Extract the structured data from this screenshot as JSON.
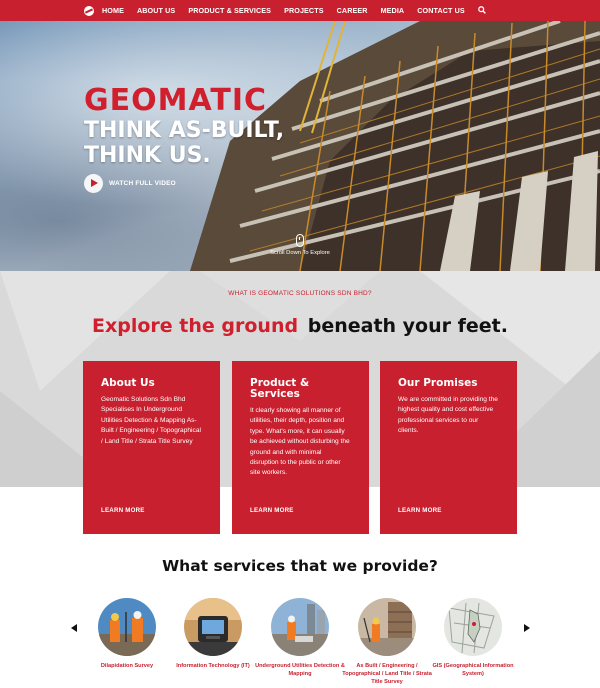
{
  "nav": {
    "items": [
      "HOME",
      "ABOUT US",
      "PRODUCT & SERVICES",
      "PROJECTS",
      "CAREER",
      "MEDIA",
      "CONTACT US"
    ],
    "search_icon": "search-icon",
    "accent": "#c8202e"
  },
  "hero": {
    "brand": "GEOMATIC",
    "headline_line1": "THINK AS-BUILT,",
    "headline_line2": "THINK US.",
    "watch_label": "WATCH FULL VIDEO",
    "scroll_label": "Scroll Down To Explore"
  },
  "intro": {
    "eyebrow": "WHAT IS GEOMATIC SOLUTIONS SDN BHD?",
    "title_red": "Explore the ground",
    "title_dark": "beneath your feet."
  },
  "cards": [
    {
      "title": "About Us",
      "body": "Geomatic Solutions Sdn Bhd Specialises In Underground Utilities Detection & Mapping As-Built / Engineering / Topographical / Land Title / Strata Title Survey",
      "more": "LEARN MORE"
    },
    {
      "title": "Product & Services",
      "body": "It clearly showing all manner of utilities, their depth, position and type. What's more, it can usually be achieved without disturbing the ground and with minimal disruption to the public or other site workers.",
      "more": "LEARN MORE"
    },
    {
      "title": "Our Promises",
      "body": "We are committed in providing the highest quality and cost effective professional services to our clients.",
      "more": "LEARN MORE"
    }
  ],
  "services": {
    "title": "What services that we provide?",
    "items": [
      {
        "label": "Dilapidation Survey"
      },
      {
        "label": "Information Technology (IT)"
      },
      {
        "label": "Underground Utilities Detection & Mapping"
      },
      {
        "label": "As Built / Engineering / Topographical / Land Title / Strata Title Survey"
      },
      {
        "label": "GIS (Geographical Information System)"
      }
    ]
  }
}
